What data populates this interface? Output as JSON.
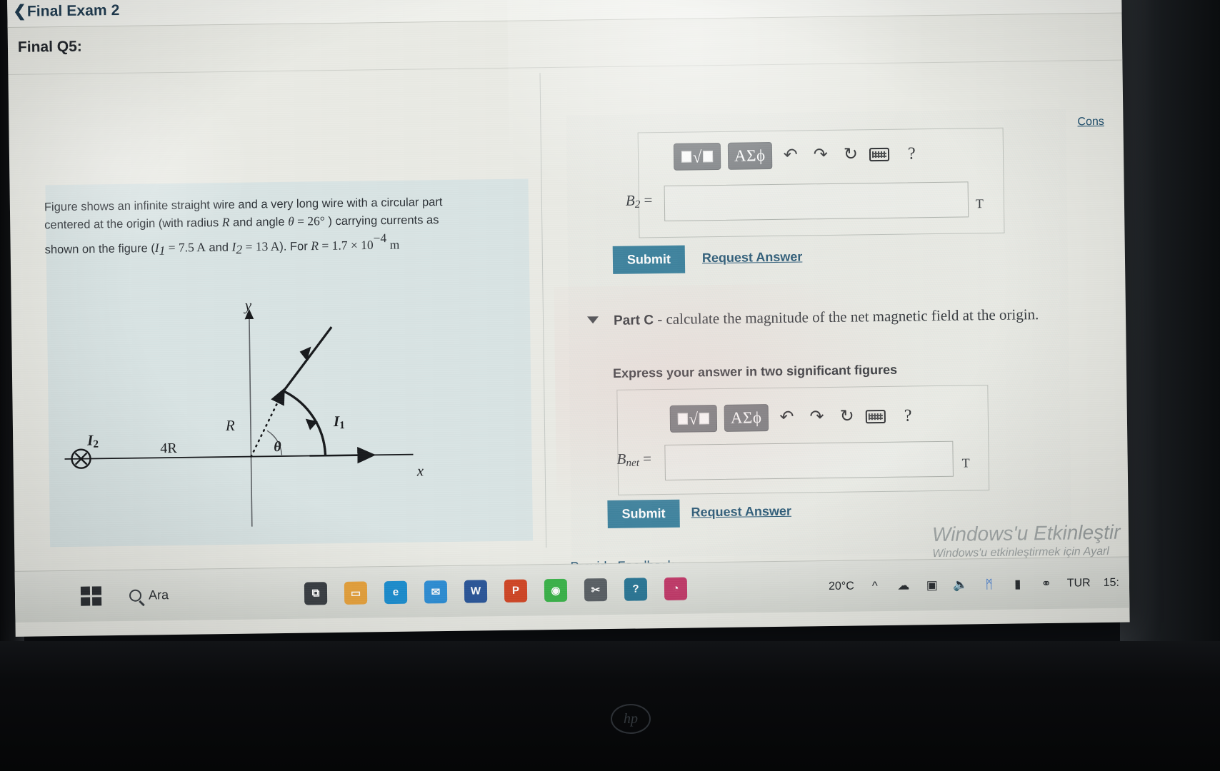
{
  "header": {
    "back_chevron": "chevron-left-icon",
    "back_label": "Final Exam 2",
    "question_title": "Final Q5:"
  },
  "problem": {
    "line1": "Figure shows an infinite straight wire and a very long wire with a circular part",
    "line2_a": "centered at the origin  (with radius ",
    "line2_R": "R",
    "line2_b": " and angle ",
    "line2_theta": "θ",
    "line2_eq": " = 26°",
    "line2_c": " ) carrying currents as",
    "line3_a": "shown on the figure (",
    "line3_I1": "I",
    "line3_I1sub": "1",
    "line3_eq1": " = 7.5 A",
    "line3_and": "  and  ",
    "line3_I2": "I",
    "line3_I2sub": "2",
    "line3_eq2": " = 13 A",
    "line3_b": "). For ",
    "line3_R": "R",
    "line3_eq3": " = 1.7 × 10",
    "line3_exp": "−4",
    "line3_unit": " m",
    "angle_value": "26",
    "I1_value": "7.5",
    "I2_value": "13",
    "R_value": "1.7 × 10^-4"
  },
  "figure": {
    "y_axis_label": "y",
    "x_axis_label": "x",
    "radius_label": "R",
    "angle_label": "θ",
    "current1_label": "I",
    "current1_sub": "1",
    "current2_label": "I",
    "current2_sub": "2",
    "distance_label": "4R",
    "into_page_symbol": "✕"
  },
  "consult": {
    "label": "Cons"
  },
  "part_b": {
    "variable": "B",
    "variable_sub": "2",
    "equals": "=",
    "unit": "T",
    "input_value": "",
    "submit_label": "Submit",
    "request_label": "Request Answer"
  },
  "part_c": {
    "caret": "caret-down-icon",
    "label": "Part C",
    "dash": "-",
    "description": "calculate the magnitude of the net magnetic field  at the origin.",
    "instruction": "Express your answer in two significant figures",
    "variable": "B",
    "variable_sub": "net",
    "equals": "=",
    "unit": "T",
    "input_value": "",
    "submit_label": "Submit",
    "request_label": "Request Answer"
  },
  "mathbar": {
    "template_icon": "math-template-icon",
    "root_glyph": "√",
    "greek_label": "ΑΣϕ",
    "undo_glyph": "↶",
    "redo_glyph": "↷",
    "reset_glyph": "↻",
    "keyboard_icon": "keyboard-icon",
    "help_glyph": "?"
  },
  "footer": {
    "provide_feedback": "Provide Feedback"
  },
  "watermark": {
    "line1": "Windows'u Etkinleştir",
    "line2": "Windows'u etkinleştirmek için Ayarl"
  },
  "taskbar": {
    "start_icon": "windows-start-icon",
    "search_icon": "search-icon",
    "search_label": "Ara",
    "apps": [
      {
        "name": "task-view-icon",
        "glyph": "⧉",
        "color": "#3a3f44"
      },
      {
        "name": "file-explorer-icon",
        "glyph": "▭",
        "color": "#e8a33d"
      },
      {
        "name": "edge-icon",
        "glyph": "e",
        "color": "#1b8fd1"
      },
      {
        "name": "mail-icon",
        "glyph": "✉",
        "color": "#2e8fd6"
      },
      {
        "name": "word-icon",
        "glyph": "W",
        "color": "#2b579a"
      },
      {
        "name": "powerpoint-icon",
        "glyph": "P",
        "color": "#d24726"
      },
      {
        "name": "chrome-icon",
        "glyph": "◉",
        "color": "#3bb44a"
      },
      {
        "name": "snipping-tool-icon",
        "glyph": "✂",
        "color": "#5a6065"
      },
      {
        "name": "help-icon",
        "glyph": "?",
        "color": "#2b7796"
      },
      {
        "name": "weather-app-icon",
        "glyph": "◔",
        "color": "#c23b6a"
      }
    ],
    "weather_temp": "20°C",
    "tray": [
      {
        "name": "show-hidden-icons-icon",
        "glyph": "⌃"
      },
      {
        "name": "onedrive-icon",
        "glyph": "☁"
      },
      {
        "name": "screenshot-icon",
        "glyph": "❑"
      },
      {
        "name": "volume-icon",
        "glyph": "◁"
      },
      {
        "name": "bluetooth-icon",
        "glyph": "ᛗ"
      },
      {
        "name": "battery-icon",
        "glyph": "▬"
      },
      {
        "name": "network-icon",
        "glyph": "⚲"
      }
    ],
    "language": "TUR",
    "clock": "15:"
  },
  "device": {
    "brand": "hp"
  },
  "colors": {
    "accent": "#2b7796",
    "link": "#1d4f6e",
    "page_bg": "#e9eae4",
    "selection": "#aed0e4",
    "mathbar_btn": "#6f7276"
  }
}
